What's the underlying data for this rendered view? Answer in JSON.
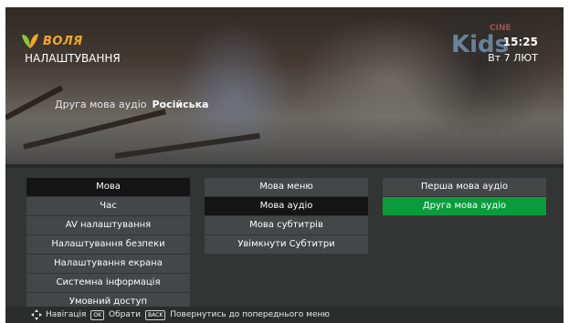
{
  "header": {
    "brand": "ВОЛЯ",
    "page_title": "НАЛАШТУВАННЯ",
    "channel_logo": {
      "main": "Kids",
      "sub": "CINE"
    },
    "time": "15:25",
    "date": "Вт 7 ЛЮТ"
  },
  "current_setting": {
    "label": "Друга мова аудіо",
    "value": "Російська"
  },
  "menu": {
    "column1": [
      "Мова",
      "Час",
      "AV налаштування",
      "Налаштування безпеки",
      "Налаштування екрана",
      "Системна інформація",
      "Умовний доступ"
    ],
    "column2": [
      "Мова меню",
      "Мова аудіо",
      "Мова субтитрів",
      "Увімкнути Субтитри"
    ],
    "column3": [
      "Перша мова аудіо",
      "Друга мова аудіо"
    ]
  },
  "footer": {
    "nav_label": "Навігація",
    "ok_key": "OK",
    "ok_label": "Обрати",
    "back_key": "BACK",
    "back_label": "Повернутись до попереднього меню"
  },
  "colors": {
    "brand": "#f5a623",
    "selected_green": "#0a9c3c",
    "selected_dark": "#151515",
    "menu_item": "#444747"
  }
}
